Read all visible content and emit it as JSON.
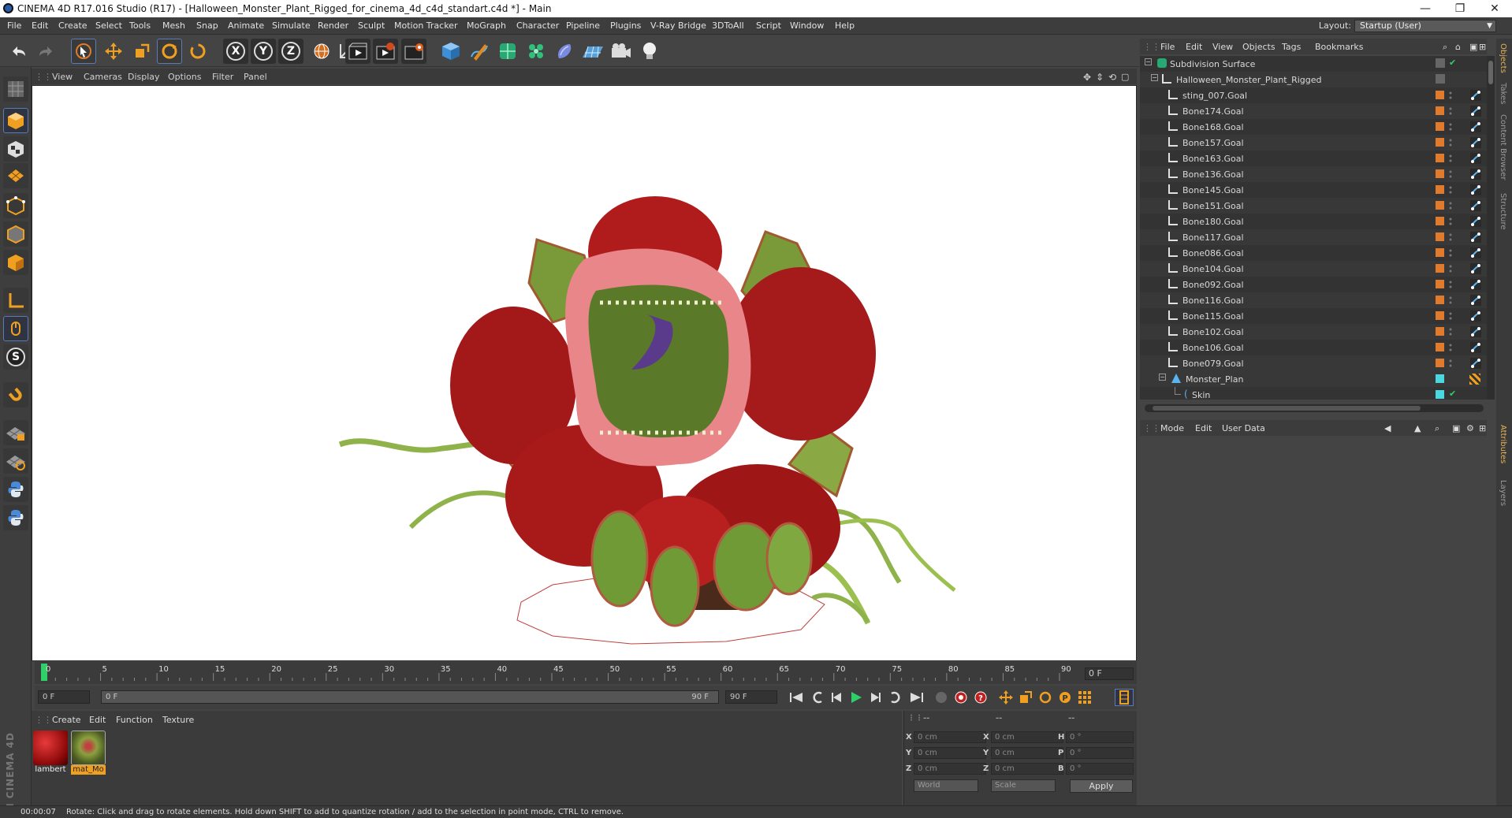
{
  "window": {
    "title": "CINEMA 4D R17.016 Studio (R17) - [Halloween_Monster_Plant_Rigged_for_cinema_4d_c4d_standart.c4d *] - Main",
    "controls": [
      "—",
      "❐",
      "✕"
    ]
  },
  "menu": {
    "items": [
      "File",
      "Edit",
      "Create",
      "Select",
      "Tools",
      "Mesh",
      "Snap",
      "Animate",
      "Simulate",
      "Render",
      "Sculpt",
      "Motion Tracker",
      "MoGraph",
      "Character",
      "Pipeline",
      "Plugins",
      "V-Ray Bridge",
      "3DToAll",
      "Script",
      "Window",
      "Help"
    ],
    "layout_label": "Layout:",
    "layout_value": "Startup (User)"
  },
  "toolbar": {
    "axis_labels": [
      "X",
      "Y",
      "Z"
    ],
    "icons": [
      "undo-icon",
      "redo-icon",
      "select-icon",
      "move-icon",
      "scale-icon",
      "rotate-icon",
      "rotate-recent-icon",
      "x-axis-icon",
      "y-axis-icon",
      "z-axis-icon",
      "world-coords-icon",
      "coordinate-system-icon",
      "render-view-icon",
      "render-picture-viewer-icon",
      "edit-render-settings-icon",
      "cube-icon",
      "pen-icon",
      "subdivision-icon",
      "cloner-icon",
      "deformer-icon",
      "floor-icon",
      "camera-icon",
      "light-icon"
    ]
  },
  "left_tools": {
    "icons": [
      "make-editable-icon",
      "model-mode-icon",
      "texture-mode-icon",
      "workplane-mode-icon",
      "points-mode-icon",
      "edges-mode-icon",
      "polygons-mode-icon",
      "axis-mode-icon",
      "tweak-mode-icon",
      "snap-s-icon",
      "magnet-icon",
      "lock-workplane-icon",
      "workplane-snap-icon",
      "python-icon",
      "python-alt-icon"
    ],
    "snap_letter": "S"
  },
  "viewport": {
    "menu": [
      "View",
      "Cameras",
      "Display",
      "Options",
      "Filter",
      "Panel"
    ]
  },
  "timeline": {
    "ticks": [
      "0",
      "5",
      "10",
      "15",
      "20",
      "25",
      "30",
      "35",
      "40",
      "45",
      "50",
      "55",
      "60",
      "65",
      "70",
      "75",
      "80",
      "85",
      "90"
    ],
    "current_frame": "0 F",
    "start_field": "0 F",
    "slider_start": "0 F",
    "slider_end": "90 F",
    "end_field": "90 F"
  },
  "materials": {
    "menu": [
      "Create",
      "Edit",
      "Function",
      "Texture"
    ],
    "items": [
      {
        "name": "lambert",
        "selected": false,
        "color": "#b50f0f"
      },
      {
        "name": "mat_Mo",
        "selected": true,
        "color": "#7a8a3a"
      }
    ]
  },
  "coordinates": {
    "headers": [
      "--",
      "--",
      "--"
    ],
    "rows": [
      {
        "l1": "X",
        "v1": "0 cm",
        "l2": "X",
        "v2": "0 cm",
        "l3": "H",
        "v3": "0 °"
      },
      {
        "l1": "Y",
        "v1": "0 cm",
        "l2": "Y",
        "v2": "0 cm",
        "l3": "P",
        "v3": "0 °"
      },
      {
        "l1": "Z",
        "v1": "0 cm",
        "l2": "Z",
        "v2": "0 cm",
        "l3": "B",
        "v3": "0 °"
      }
    ],
    "mode_world": "World",
    "mode_scale": "Scale",
    "apply": "Apply"
  },
  "object_manager": {
    "menu": [
      "File",
      "Edit",
      "View",
      "Objects",
      "Tags",
      "Bookmarks"
    ],
    "rows": [
      {
        "name": "Subdivision Surface",
        "type": "subdiv"
      },
      {
        "name": "Halloween_Monster_Plant_Rigged",
        "type": "null"
      },
      {
        "name": "sting_007.Goal",
        "type": "goal"
      },
      {
        "name": "Bone174.Goal",
        "type": "goal"
      },
      {
        "name": "Bone168.Goal",
        "type": "goal"
      },
      {
        "name": "Bone157.Goal",
        "type": "goal"
      },
      {
        "name": "Bone163.Goal",
        "type": "goal"
      },
      {
        "name": "Bone136.Goal",
        "type": "goal"
      },
      {
        "name": "Bone145.Goal",
        "type": "goal"
      },
      {
        "name": "Bone151.Goal",
        "type": "goal"
      },
      {
        "name": "Bone180.Goal",
        "type": "goal"
      },
      {
        "name": "Bone117.Goal",
        "type": "goal"
      },
      {
        "name": "Bone086.Goal",
        "type": "goal"
      },
      {
        "name": "Bone104.Goal",
        "type": "goal"
      },
      {
        "name": "Bone092.Goal",
        "type": "goal"
      },
      {
        "name": "Bone116.Goal",
        "type": "goal"
      },
      {
        "name": "Bone115.Goal",
        "type": "goal"
      },
      {
        "name": "Bone102.Goal",
        "type": "goal"
      },
      {
        "name": "Bone106.Goal",
        "type": "goal"
      },
      {
        "name": "Bone079.Goal",
        "type": "goal"
      },
      {
        "name": "Monster_Plan",
        "type": "mesh"
      },
      {
        "name": "Skin",
        "type": "skin"
      }
    ]
  },
  "attributes": {
    "menu": [
      "Mode",
      "Edit",
      "User Data"
    ]
  },
  "right_tabs": [
    "Objects",
    "Takes",
    "Content Browser",
    "Structure",
    "Attributes",
    "Layers"
  ],
  "maxon_logo": "MAXON CINEMA 4D",
  "status": {
    "time": "00:00:07",
    "message": "Rotate: Click and drag to rotate elements. Hold down SHIFT to add to quantize rotation / add to the selection in point mode, CTRL to remove."
  }
}
